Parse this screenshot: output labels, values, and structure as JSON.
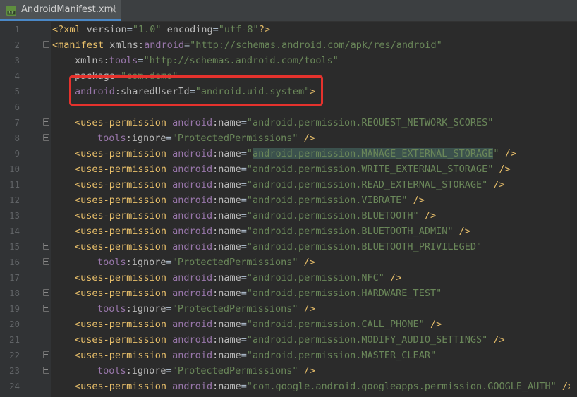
{
  "tab": {
    "filename": "AndroidManifest.xml",
    "close": "×",
    "icon": "manifest-file-icon"
  },
  "lines": [
    {
      "n": "1",
      "indent": 0,
      "fold": false,
      "tokens": [
        {
          "t": "<?xml ",
          "c": "tag"
        },
        {
          "t": "version",
          "c": "attr"
        },
        {
          "t": "=",
          "c": "sep"
        },
        {
          "t": "\"1.0\"",
          "c": "str"
        },
        {
          "t": " ",
          "c": "sep"
        },
        {
          "t": "encoding",
          "c": "attr"
        },
        {
          "t": "=",
          "c": "sep"
        },
        {
          "t": "\"utf-8\"",
          "c": "str"
        },
        {
          "t": "?>",
          "c": "tag"
        }
      ]
    },
    {
      "n": "2",
      "indent": 0,
      "fold": true,
      "tokens": [
        {
          "t": "<manifest ",
          "c": "tag"
        },
        {
          "t": "xmlns:",
          "c": "attr"
        },
        {
          "t": "android",
          "c": "ns"
        },
        {
          "t": "=",
          "c": "sep"
        },
        {
          "t": "\"http://schemas.android.com/apk/res/android\"",
          "c": "str"
        }
      ]
    },
    {
      "n": "3",
      "indent": 1,
      "fold": false,
      "tokens": [
        {
          "t": "xmlns:",
          "c": "attr"
        },
        {
          "t": "tools",
          "c": "ns"
        },
        {
          "t": "=",
          "c": "sep"
        },
        {
          "t": "\"http://schemas.android.com/tools\"",
          "c": "str"
        }
      ]
    },
    {
      "n": "4",
      "indent": 1,
      "fold": false,
      "tokens": [
        {
          "t": "package",
          "c": "attr"
        },
        {
          "t": "=",
          "c": "sep"
        },
        {
          "t": "\"com.demo\"",
          "c": "str"
        }
      ]
    },
    {
      "n": "5",
      "indent": 1,
      "fold": false,
      "tokens": [
        {
          "t": "android",
          "c": "ns"
        },
        {
          "t": ":sharedUserId",
          "c": "attr"
        },
        {
          "t": "=",
          "c": "sep"
        },
        {
          "t": "\"android.uid.system\"",
          "c": "str"
        },
        {
          "t": ">",
          "c": "tag"
        }
      ]
    },
    {
      "n": "6",
      "indent": 0,
      "fold": false,
      "tokens": []
    },
    {
      "n": "7",
      "indent": 1,
      "fold": true,
      "tokens": [
        {
          "t": "<uses-permission ",
          "c": "tag"
        },
        {
          "t": "android",
          "c": "ns"
        },
        {
          "t": ":name",
          "c": "attr"
        },
        {
          "t": "=",
          "c": "sep"
        },
        {
          "t": "\"android.permission.REQUEST_NETWORK_SCORES\"",
          "c": "str"
        }
      ]
    },
    {
      "n": "8",
      "indent": 2,
      "fold": true,
      "tokens": [
        {
          "t": "tools",
          "c": "ns"
        },
        {
          "t": ":ignore",
          "c": "attr"
        },
        {
          "t": "=",
          "c": "sep"
        },
        {
          "t": "\"ProtectedPermissions\"",
          "c": "str"
        },
        {
          "t": " />",
          "c": "tag"
        }
      ]
    },
    {
      "n": "9",
      "indent": 1,
      "fold": false,
      "tokens": [
        {
          "t": "<uses-permission ",
          "c": "tag"
        },
        {
          "t": "android",
          "c": "ns"
        },
        {
          "t": ":name",
          "c": "attr"
        },
        {
          "t": "=",
          "c": "sep"
        },
        {
          "t": "\"",
          "c": "str"
        },
        {
          "t": "android.permission.MANAGE_EXTERNAL_STORAGE",
          "c": "str hl"
        },
        {
          "t": "\"",
          "c": "str"
        },
        {
          "t": " />",
          "c": "tag"
        }
      ]
    },
    {
      "n": "10",
      "indent": 1,
      "fold": false,
      "tokens": [
        {
          "t": "<uses-permission ",
          "c": "tag"
        },
        {
          "t": "android",
          "c": "ns"
        },
        {
          "t": ":name",
          "c": "attr"
        },
        {
          "t": "=",
          "c": "sep"
        },
        {
          "t": "\"android.permission.WRITE_EXTERNAL_STORAGE\"",
          "c": "str"
        },
        {
          "t": " />",
          "c": "tag"
        }
      ]
    },
    {
      "n": "11",
      "indent": 1,
      "fold": false,
      "tokens": [
        {
          "t": "<uses-permission ",
          "c": "tag"
        },
        {
          "t": "android",
          "c": "ns"
        },
        {
          "t": ":name",
          "c": "attr"
        },
        {
          "t": "=",
          "c": "sep"
        },
        {
          "t": "\"android.permission.READ_EXTERNAL_STORAGE\"",
          "c": "str"
        },
        {
          "t": " />",
          "c": "tag"
        }
      ]
    },
    {
      "n": "12",
      "indent": 1,
      "fold": false,
      "tokens": [
        {
          "t": "<uses-permission ",
          "c": "tag"
        },
        {
          "t": "android",
          "c": "ns"
        },
        {
          "t": ":name",
          "c": "attr"
        },
        {
          "t": "=",
          "c": "sep"
        },
        {
          "t": "\"android.permission.VIBRATE\"",
          "c": "str"
        },
        {
          "t": " />",
          "c": "tag"
        }
      ]
    },
    {
      "n": "13",
      "indent": 1,
      "fold": false,
      "tokens": [
        {
          "t": "<uses-permission ",
          "c": "tag"
        },
        {
          "t": "android",
          "c": "ns"
        },
        {
          "t": ":name",
          "c": "attr"
        },
        {
          "t": "=",
          "c": "sep"
        },
        {
          "t": "\"android.permission.BLUETOOTH\"",
          "c": "str"
        },
        {
          "t": " />",
          "c": "tag"
        }
      ]
    },
    {
      "n": "14",
      "indent": 1,
      "fold": false,
      "tokens": [
        {
          "t": "<uses-permission ",
          "c": "tag"
        },
        {
          "t": "android",
          "c": "ns"
        },
        {
          "t": ":name",
          "c": "attr"
        },
        {
          "t": "=",
          "c": "sep"
        },
        {
          "t": "\"android.permission.BLUETOOTH_ADMIN\"",
          "c": "str"
        },
        {
          "t": " />",
          "c": "tag"
        }
      ]
    },
    {
      "n": "15",
      "indent": 1,
      "fold": true,
      "tokens": [
        {
          "t": "<uses-permission ",
          "c": "tag"
        },
        {
          "t": "android",
          "c": "ns"
        },
        {
          "t": ":name",
          "c": "attr"
        },
        {
          "t": "=",
          "c": "sep"
        },
        {
          "t": "\"android.permission.BLUETOOTH_PRIVILEGED\"",
          "c": "str"
        }
      ]
    },
    {
      "n": "16",
      "indent": 2,
      "fold": true,
      "tokens": [
        {
          "t": "tools",
          "c": "ns"
        },
        {
          "t": ":ignore",
          "c": "attr"
        },
        {
          "t": "=",
          "c": "sep"
        },
        {
          "t": "\"ProtectedPermissions\"",
          "c": "str"
        },
        {
          "t": " />",
          "c": "tag"
        }
      ]
    },
    {
      "n": "17",
      "indent": 1,
      "fold": false,
      "tokens": [
        {
          "t": "<uses-permission ",
          "c": "tag"
        },
        {
          "t": "android",
          "c": "ns"
        },
        {
          "t": ":name",
          "c": "attr"
        },
        {
          "t": "=",
          "c": "sep"
        },
        {
          "t": "\"android.permission.NFC\"",
          "c": "str"
        },
        {
          "t": " />",
          "c": "tag"
        }
      ]
    },
    {
      "n": "18",
      "indent": 1,
      "fold": true,
      "tokens": [
        {
          "t": "<uses-permission ",
          "c": "tag"
        },
        {
          "t": "android",
          "c": "ns"
        },
        {
          "t": ":name",
          "c": "attr"
        },
        {
          "t": "=",
          "c": "sep"
        },
        {
          "t": "\"android.permission.HARDWARE_TEST\"",
          "c": "str"
        }
      ]
    },
    {
      "n": "19",
      "indent": 2,
      "fold": true,
      "tokens": [
        {
          "t": "tools",
          "c": "ns"
        },
        {
          "t": ":ignore",
          "c": "attr"
        },
        {
          "t": "=",
          "c": "sep"
        },
        {
          "t": "\"ProtectedPermissions\"",
          "c": "str"
        },
        {
          "t": " />",
          "c": "tag"
        }
      ]
    },
    {
      "n": "20",
      "indent": 1,
      "fold": false,
      "tokens": [
        {
          "t": "<uses-permission ",
          "c": "tag"
        },
        {
          "t": "android",
          "c": "ns"
        },
        {
          "t": ":name",
          "c": "attr"
        },
        {
          "t": "=",
          "c": "sep"
        },
        {
          "t": "\"android.permission.CALL_PHONE\"",
          "c": "str"
        },
        {
          "t": " />",
          "c": "tag"
        }
      ]
    },
    {
      "n": "21",
      "indent": 1,
      "fold": false,
      "tokens": [
        {
          "t": "<uses-permission ",
          "c": "tag"
        },
        {
          "t": "android",
          "c": "ns"
        },
        {
          "t": ":name",
          "c": "attr"
        },
        {
          "t": "=",
          "c": "sep"
        },
        {
          "t": "\"android.permission.MODIFY_AUDIO_SETTINGS\"",
          "c": "str"
        },
        {
          "t": " />",
          "c": "tag"
        }
      ]
    },
    {
      "n": "22",
      "indent": 1,
      "fold": true,
      "tokens": [
        {
          "t": "<uses-permission ",
          "c": "tag"
        },
        {
          "t": "android",
          "c": "ns"
        },
        {
          "t": ":name",
          "c": "attr"
        },
        {
          "t": "=",
          "c": "sep"
        },
        {
          "t": "\"android.permission.MASTER_CLEAR\"",
          "c": "str"
        }
      ]
    },
    {
      "n": "23",
      "indent": 2,
      "fold": true,
      "tokens": [
        {
          "t": "tools",
          "c": "ns"
        },
        {
          "t": ":ignore",
          "c": "attr"
        },
        {
          "t": "=",
          "c": "sep"
        },
        {
          "t": "\"ProtectedPermissions\"",
          "c": "str"
        },
        {
          "t": " />",
          "c": "tag"
        }
      ]
    },
    {
      "n": "24",
      "indent": 1,
      "fold": false,
      "tokens": [
        {
          "t": "<uses-permission ",
          "c": "tag"
        },
        {
          "t": "android",
          "c": "ns"
        },
        {
          "t": ":name",
          "c": "attr"
        },
        {
          "t": "=",
          "c": "sep"
        },
        {
          "t": "\"com.google.android.googleapps.permission.GOOGLE_AUTH\"",
          "c": "str"
        },
        {
          "t": " />",
          "c": "tag"
        }
      ]
    }
  ],
  "highlight": {
    "color": "#e5322d",
    "label": "red annotation box"
  },
  "colors": {
    "background": "#2b2b2b",
    "tag": "#e8bf6a",
    "namespace": "#9876aa",
    "string": "#6a8759",
    "attribute": "#bababa"
  }
}
